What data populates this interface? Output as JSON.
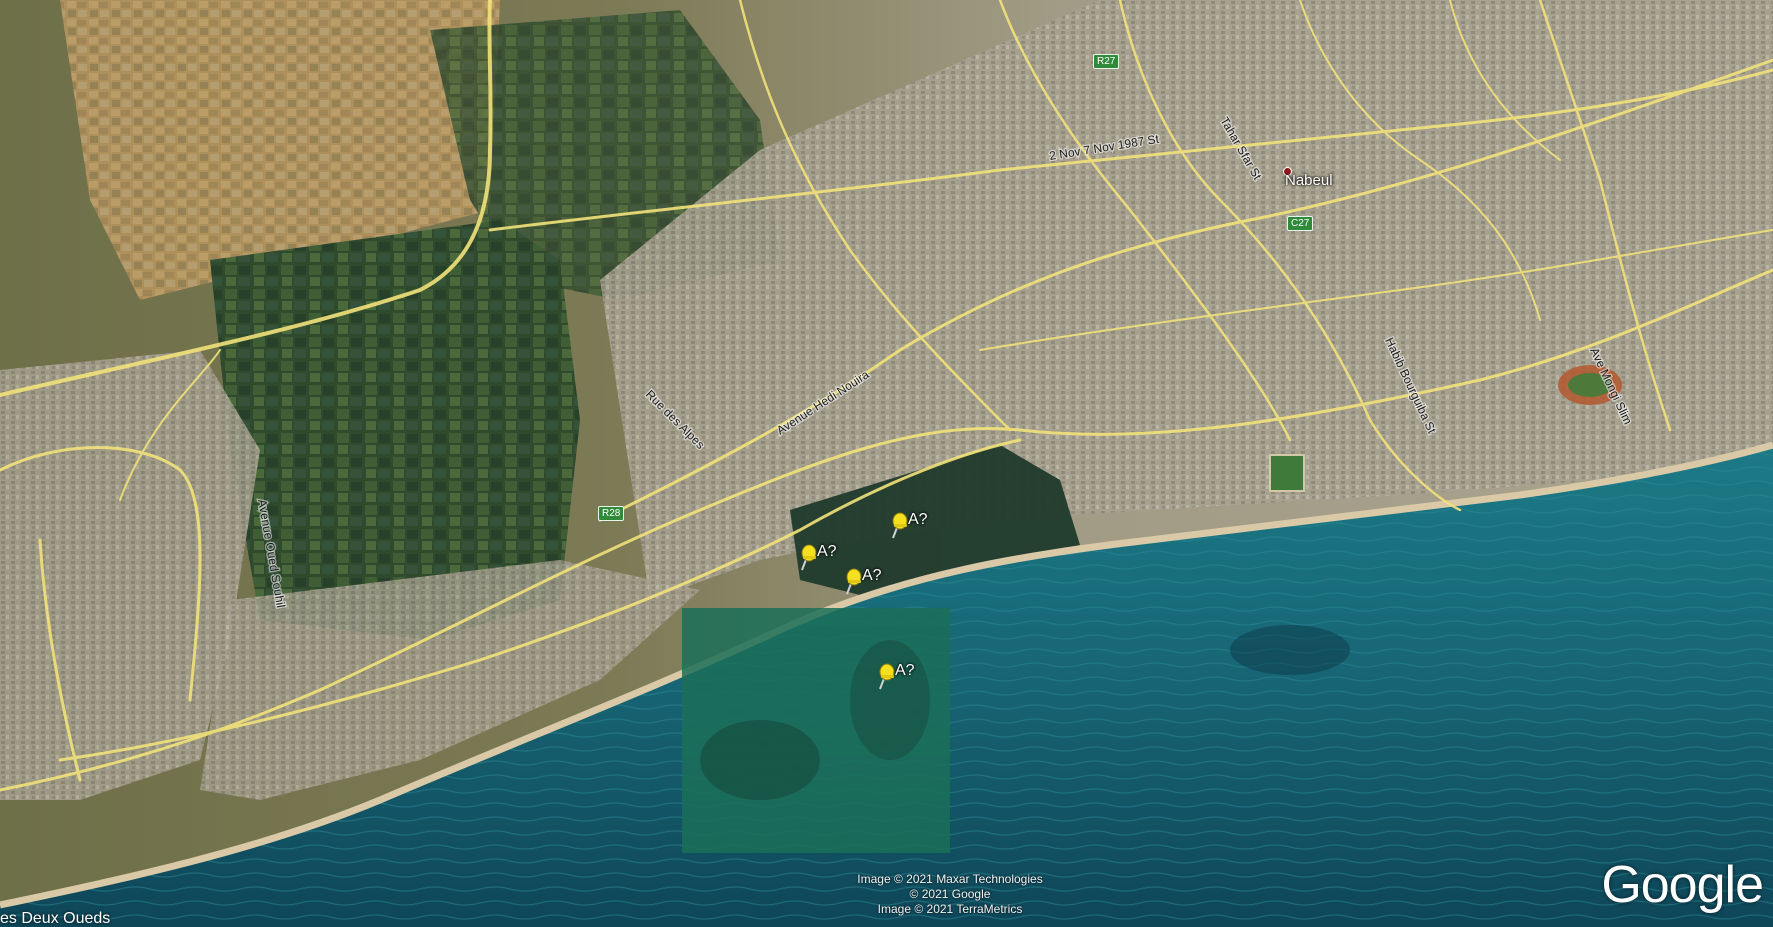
{
  "map": {
    "city": {
      "name": "Nabeul"
    },
    "shields": [
      "R27",
      "C27",
      "R28"
    ],
    "road_labels": {
      "nov7": "2 Nov 7 Nov 1987 St",
      "nouira": "Avenue Hedi Nouira",
      "alpes": "Rue des Alpes",
      "oued_souhil": "Avenue Oued Souhil",
      "mongi": "Ave Mongi Slim",
      "bourguiba": "Habib Bourguiba St",
      "tahar": "Tahar Sfar St"
    },
    "pins": [
      {
        "label": "A?"
      },
      {
        "label": "A?"
      },
      {
        "label": "A?"
      },
      {
        "label": "A?"
      }
    ],
    "edge_label": "es Deux Oueds",
    "attribution": [
      "Image © 2021 Maxar Technologies",
      "© 2021 Google",
      "Image © 2021 TerraMetrics"
    ],
    "logo": "Google",
    "colors": {
      "sea": "#1f6f7a",
      "land": "#9a9478",
      "roads": "#f2e27a",
      "pin": "#f5e020"
    }
  }
}
